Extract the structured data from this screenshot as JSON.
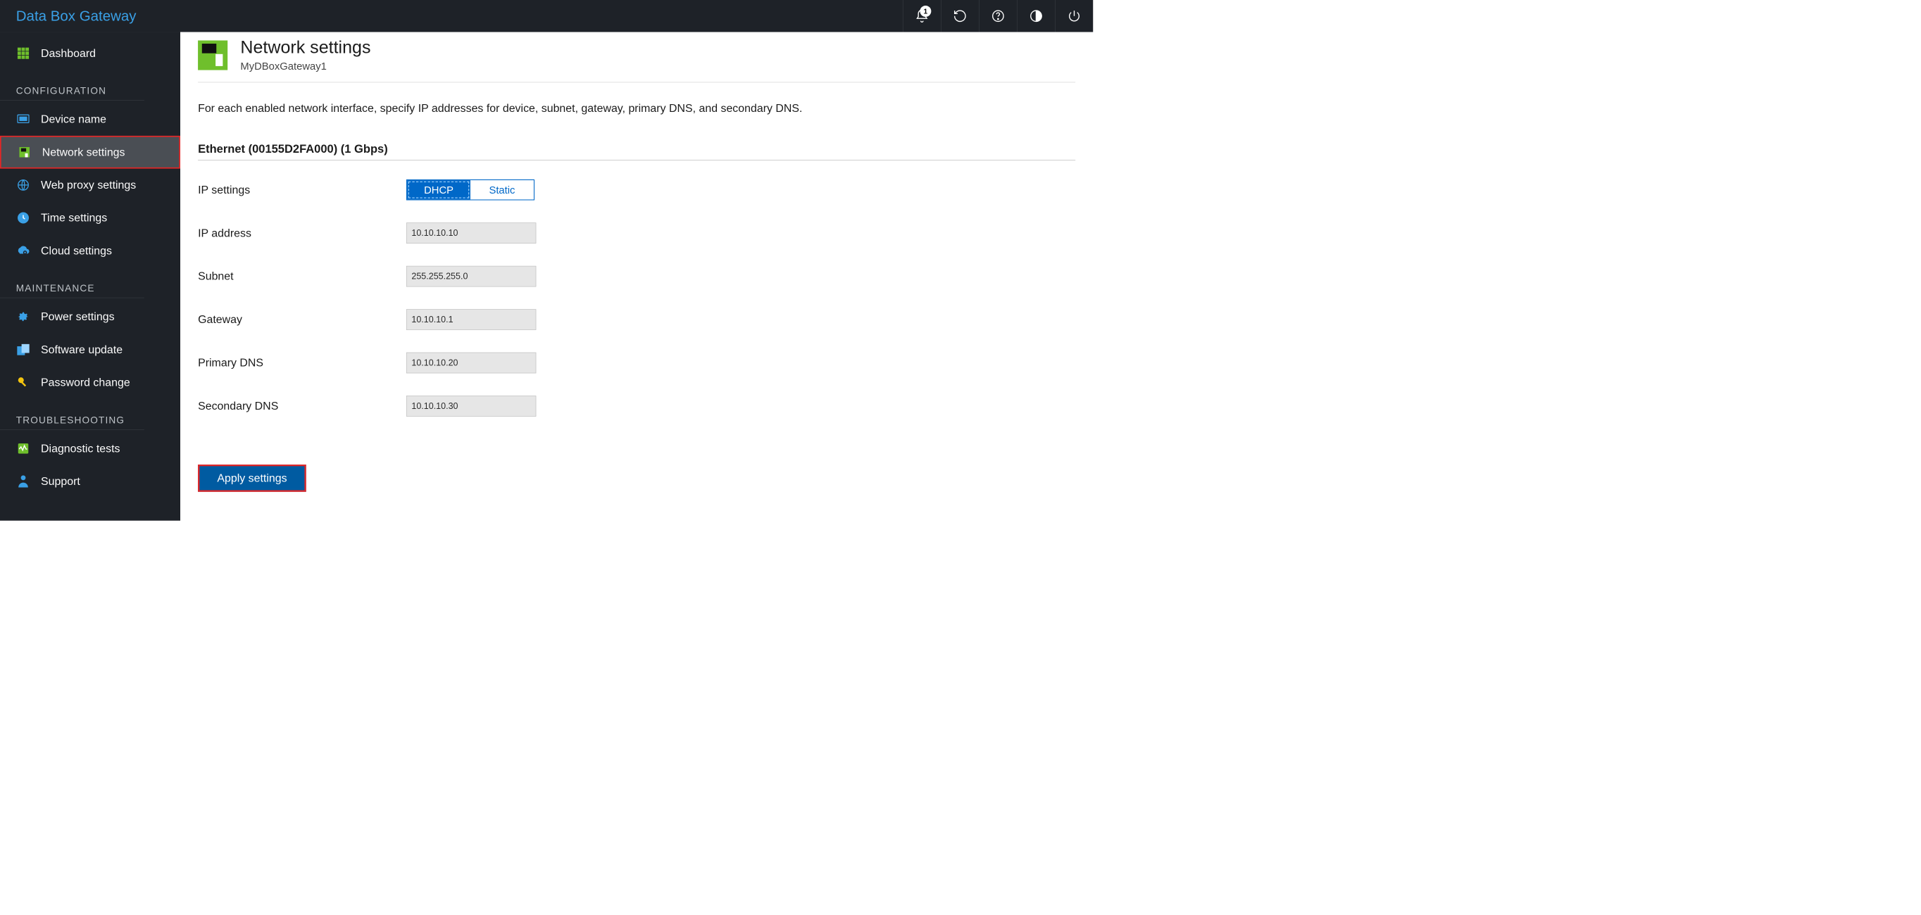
{
  "header": {
    "brand": "Data Box Gateway",
    "notification_count": "1"
  },
  "sidebar": {
    "dashboard": "Dashboard",
    "sections": {
      "configuration": "CONFIGURATION",
      "maintenance": "MAINTENANCE",
      "troubleshooting": "TROUBLESHOOTING"
    },
    "items": {
      "device_name": "Device name",
      "network_settings": "Network settings",
      "web_proxy": "Web proxy settings",
      "time_settings": "Time settings",
      "cloud_settings": "Cloud settings",
      "power_settings": "Power settings",
      "software_update": "Software update",
      "password_change": "Password change",
      "diagnostic_tests": "Diagnostic tests",
      "support": "Support"
    }
  },
  "page": {
    "title": "Network settings",
    "subtitle": "MyDBoxGateway1",
    "description": "For each enabled network interface, specify IP addresses for device, subnet, gateway, primary DNS, and secondary DNS.",
    "interface_title": "Ethernet (00155D2FA000) (1 Gbps)"
  },
  "form": {
    "labels": {
      "ip_settings": "IP settings",
      "ip_address": "IP address",
      "subnet": "Subnet",
      "gateway": "Gateway",
      "primary_dns": "Primary DNS",
      "secondary_dns": "Secondary DNS"
    },
    "toggle": {
      "dhcp": "DHCP",
      "static": "Static"
    },
    "values": {
      "ip_address": "10.10.10.10",
      "subnet": "255.255.255.0",
      "gateway": "10.10.10.1",
      "primary_dns": "10.10.10.20",
      "secondary_dns": "10.10.10.30"
    },
    "apply": "Apply settings"
  }
}
